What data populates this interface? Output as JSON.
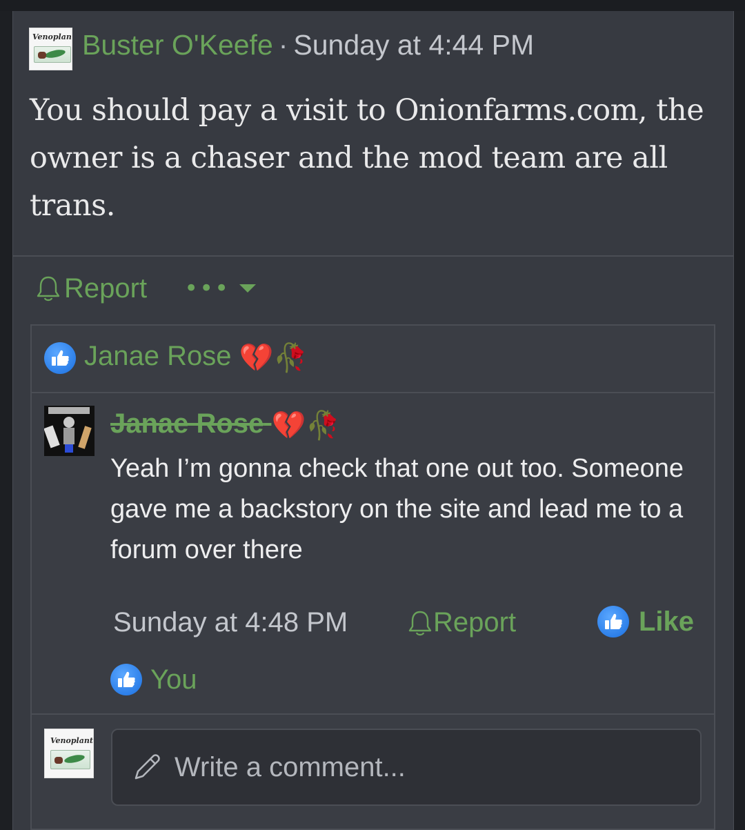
{
  "post": {
    "author": "Buster O'Keefe",
    "separator": "·",
    "date": "Sunday at 4:44 PM",
    "avatar_text": "Venoplant",
    "body": "You should pay a visit to Onionfarms.com, the owner is a chaser and the mod team are all trans.",
    "report_label": "Report",
    "more_label": "•••"
  },
  "likes": {
    "name": "Janae Rose",
    "emojis": "💔🥀"
  },
  "comment": {
    "author": "Janae Rose",
    "author_emojis": "💔🥀",
    "text": "Yeah I’m gonna check that one out too. Someone gave me a backstory on the site and lead me to a forum over there",
    "date": "Sunday at 4:48 PM",
    "report_label": "Report",
    "like_label": "Like",
    "liked_by": "You"
  },
  "composer": {
    "placeholder": "Write a comment..."
  },
  "colors": {
    "background": "#373a41",
    "accent_green": "#6aa35a",
    "like_blue": "#1a6fe0"
  },
  "icons": [
    "bell-icon",
    "chevron-down-icon",
    "thumbs-up-icon",
    "pencil-icon"
  ]
}
